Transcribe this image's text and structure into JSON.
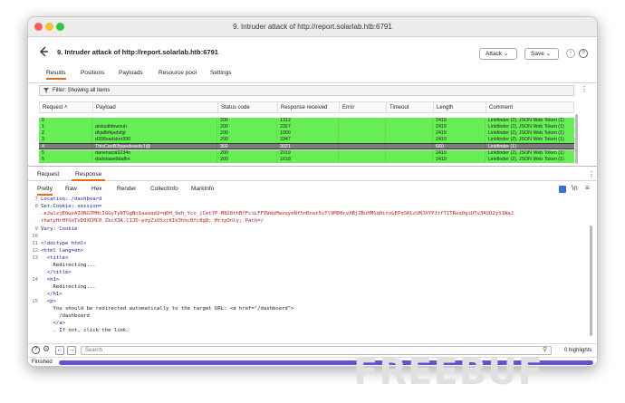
{
  "window": {
    "title": "9. Intruder attack of http://report.solarlab.htb:6791"
  },
  "header": {
    "title": "9. Intruder attack of http://report.solarlab.htb:6791",
    "attack_label": "Attack",
    "save_label": "Save"
  },
  "tabs": [
    "Results",
    "Positions",
    "Payloads",
    "Resource pool",
    "Settings"
  ],
  "filter": {
    "text": "Filter: Showing all items"
  },
  "table": {
    "columns": [
      "Request",
      "Payload",
      "Status code",
      "Response received",
      "Error",
      "Timeout",
      "Length",
      "Comment"
    ],
    "rows": [
      [
        "0",
        "",
        "200",
        "1312",
        "",
        "",
        "2419",
        "Linkfinder (2), JSON Web Token (1)"
      ],
      [
        "1",
        "alxksdhfewouh",
        "200",
        "2327",
        "",
        "",
        "2419",
        "Linkfinder (2), JSON Web Token (1)"
      ],
      [
        "2",
        "dkjafbfkjadsfgl",
        "200",
        "1000",
        "",
        "",
        "2419",
        "Linkfinder (2), JSON Web Token (1)"
      ],
      [
        "3",
        "d398sadsknr390",
        "200",
        "3347",
        "",
        "",
        "2419",
        "Linkfinder (2), JSON Web Token (1)"
      ],
      [
        "4",
        "ThisCanB3typedeasily1@",
        "302",
        "3021",
        "",
        "",
        "660",
        "Linkfinder (1)"
      ],
      [
        "5",
        "danenacia9234n",
        "200",
        "2019",
        "",
        "",
        "2419",
        "Linkfinder (2), JSON Web Token (1)"
      ],
      [
        "6",
        "dadsfawe9dafkn",
        "200",
        "1618",
        "",
        "",
        "2419",
        "Linkfinder (2), JSON Web Token (1)"
      ]
    ]
  },
  "rr_tabs": [
    "Request",
    "Response"
  ],
  "sub_tabs": [
    "Pretty",
    "Raw",
    "Hex",
    "Render",
    "CollectInfo",
    "MarkInfo"
  ],
  "code": {
    "l7": "Location: /dashboard",
    "l8a": "Set-Cookie: session=",
    "l8b": ".eJwlzjEOwzAIQNG7MHcIGGyTy8TGgNo1aaaqd2=qDH_9eh_Yco_jCet7P-M828thBfFciLFFIWdxMavqyeNf5nRnat5sTl9M00cvXBjZBuHMSqOitoGEPqSKLcUMJXYPJtfT1TRoqOgiUTv3ASD2yS1WaJ",
    "l8c": "rhwtyHrHfGoTvD0XCMC0.ZkcX3A.C1JD-pdyZiUSxiKIk3hhcBfc8g8; HttpOnly; Path=/",
    "l9": "Vary: Cookie",
    "l11": "<!doctype html>",
    "l12": "<html lang=en>",
    "l13": "  <title>",
    "l13b": "    Redirecting...",
    "l13c": "  </title>",
    "l14": "  <h1>",
    "l14b": "    Redirecting...",
    "l14c": "  </h1>",
    "l15": "  <p>",
    "l15b": "    You should be redirected automatically to the target URL: <a href=\"/dashboard\">",
    "l15c": "      /dashboard",
    "l15d": "    </a>",
    "l15e": "    . If not, click the link."
  },
  "search": {
    "placeholder": "Search",
    "highlights": "0 highlights"
  },
  "status": {
    "text": "Finished"
  },
  "watermark": {
    "text": "FREEBUF"
  },
  "colors": {
    "row_green": "#66ee55",
    "selected_row": "#7e7e7e",
    "progress": "#6a4fd6",
    "tab_accent": "#e66b1f"
  }
}
